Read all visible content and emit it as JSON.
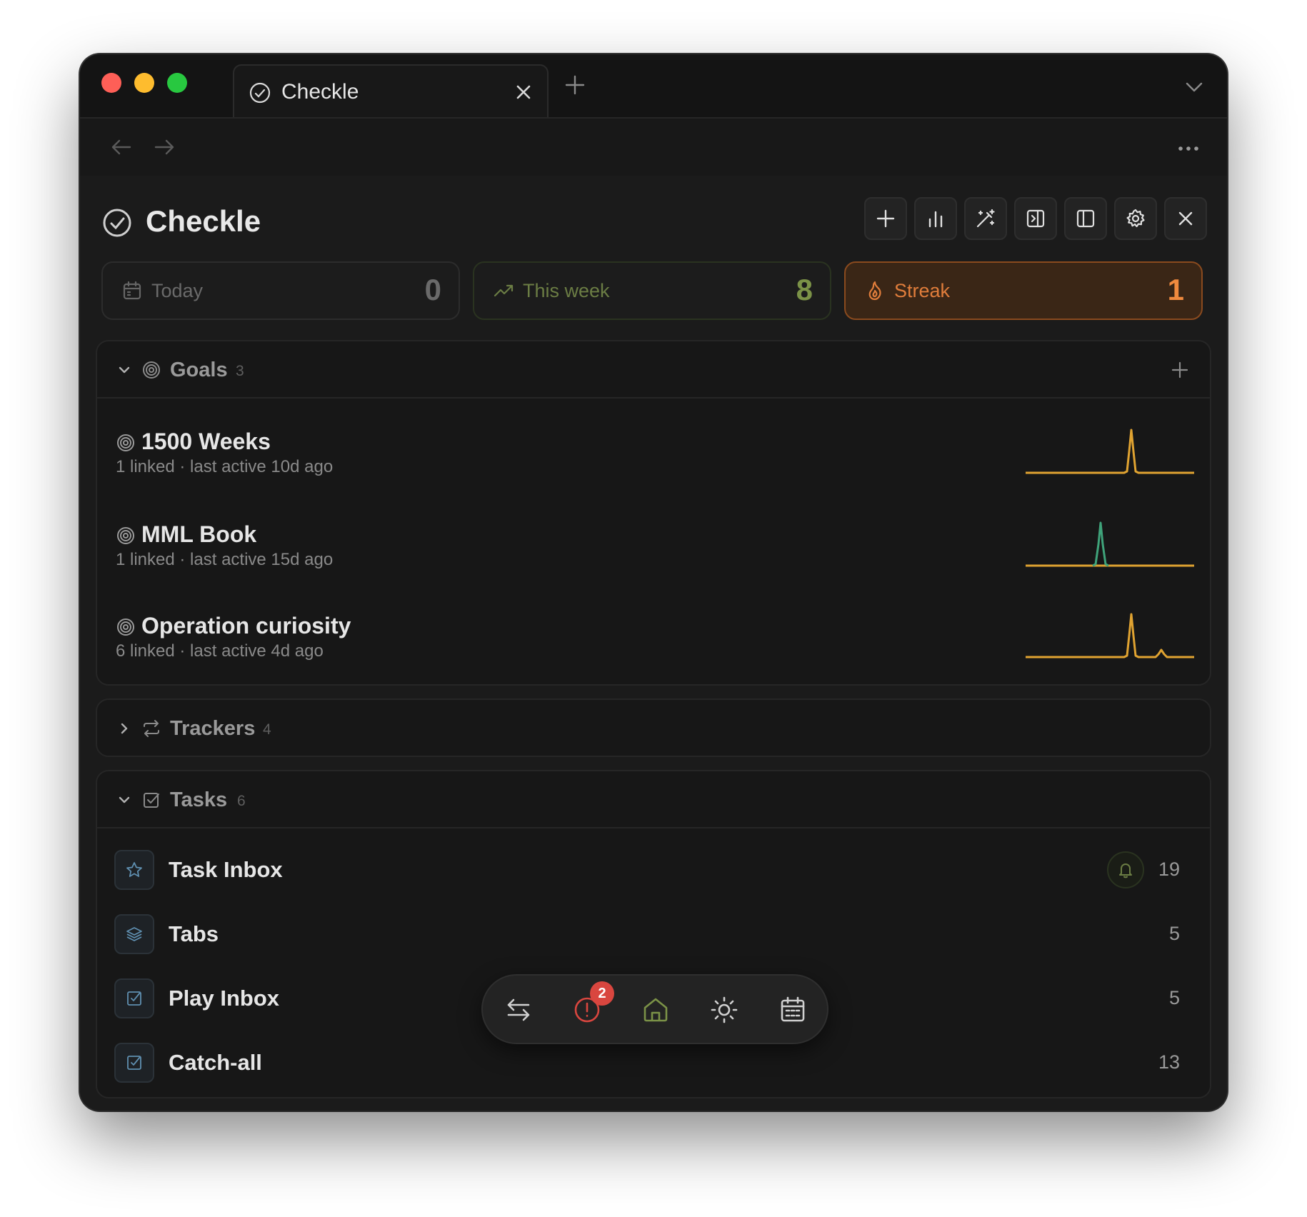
{
  "tab": {
    "title": "Checkle"
  },
  "app": {
    "title": "Checkle"
  },
  "stats": {
    "today": {
      "label": "Today",
      "value": "0"
    },
    "this_week": {
      "label": "This week",
      "value": "8"
    },
    "streak": {
      "label": "Streak",
      "value": "1"
    }
  },
  "goals": {
    "title": "Goals",
    "count": "3",
    "items": [
      {
        "title": "1500 Weeks",
        "meta": "1 linked · last active 10d ago",
        "spark_color": "#e0a331"
      },
      {
        "title": "MML Book",
        "meta": "1 linked · last active 15d ago",
        "spark_color": "#3fa37a"
      },
      {
        "title": "Operation curiosity",
        "meta": "6 linked · last active 4d ago",
        "spark_color": "#e0a331"
      }
    ]
  },
  "trackers": {
    "title": "Trackers",
    "count": "4"
  },
  "tasks": {
    "title": "Tasks",
    "count": "6",
    "items": [
      {
        "title": "Task Inbox",
        "count": "19",
        "icon": "star-icon"
      },
      {
        "title": "Tabs",
        "count": "5",
        "icon": "layers-icon"
      },
      {
        "title": "Play Inbox",
        "count": "5",
        "icon": "checkbox-icon"
      },
      {
        "title": "Catch-all",
        "count": "13",
        "icon": "checkbox-icon"
      }
    ]
  },
  "dock": {
    "alert_badge": "2"
  },
  "colors": {
    "accent_orange": "#f08a3e",
    "accent_green": "#7b9247",
    "spark_yellow": "#e0a331",
    "spark_teal": "#3fa37a",
    "alert_red": "#d9463f"
  }
}
